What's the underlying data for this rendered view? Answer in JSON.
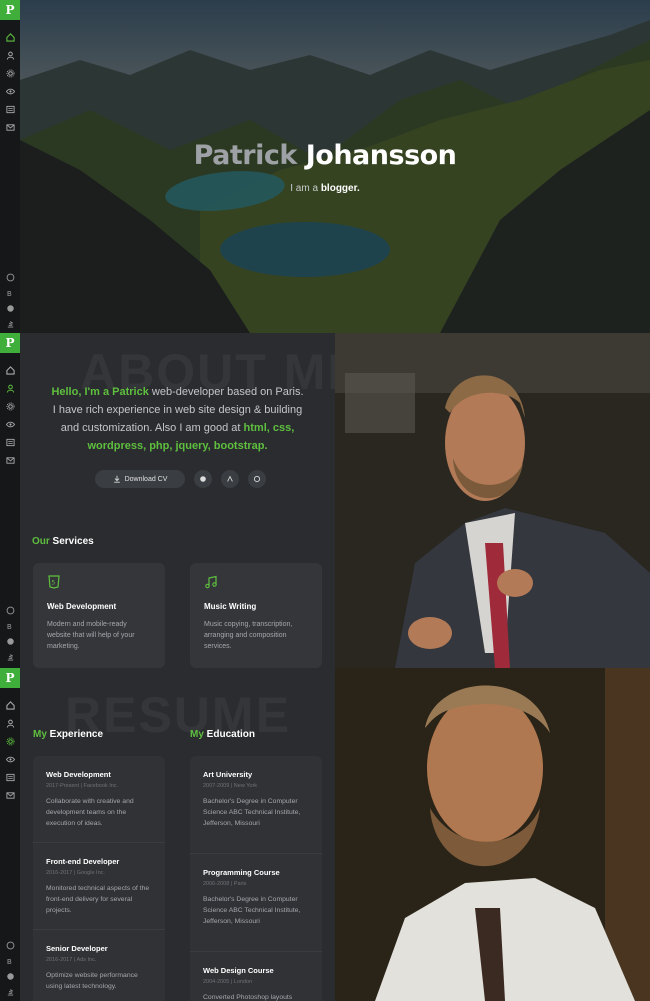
{
  "hero": {
    "first_name": "Patrick",
    "last_name": "Johansson",
    "subtitle_prefix": "I am a",
    "subtitle_role": "blogger."
  },
  "sidebar": {
    "logo": "P",
    "nav_icons": [
      "home-icon",
      "user-icon",
      "gear-icon",
      "eye-icon",
      "document-icon",
      "mail-icon"
    ],
    "social_icons": [
      "dribbble-icon",
      "behance-icon",
      "github-icon",
      "stackoverflow-icon"
    ]
  },
  "about": {
    "bg_word": "ABOUT ME",
    "greeting": "Hello, I'm a Patrick",
    "line1_rest": " web-developer based on Paris.",
    "line2": "I have rich experience in web site design & building",
    "line3_prefix": "and customization. Also I am good at ",
    "skills_a": "html, css,",
    "skills_b": "wordpress, php, jquery, bootstrap.",
    "download_label": "Download CV"
  },
  "services": {
    "title_accent": "Our",
    "title_rest": " Services",
    "items": [
      {
        "title": "Web Development",
        "desc": "Modern and mobile-ready website that will help of your marketing.",
        "icon": "html5-icon"
      },
      {
        "title": "Music Writing",
        "desc": "Music copying, transcription, arranging and composition services.",
        "icon": "music-icon"
      }
    ]
  },
  "resume": {
    "bg_word": "RESUME",
    "experience_accent": "My",
    "experience_rest": " Experience",
    "education_accent": "My",
    "education_rest": " Education",
    "experience": [
      {
        "title": "Web Development",
        "meta": "2017-Present  |  Facebook Inc.",
        "desc": "Collaborate with creative and development teams on the execution of ideas."
      },
      {
        "title": "Front-end Developer",
        "meta": "2016-2017  |  Google Inc.",
        "desc": "Monitored technical aspects of the front-end delivery for several projects."
      },
      {
        "title": "Senior Developer",
        "meta": "2016-2017  |  Ads Inc.",
        "desc": "Optimize website performance using latest technology."
      }
    ],
    "education": [
      {
        "title": "Art University",
        "meta": "2007-2009  |  New York",
        "desc": "Bachelor's Degree in Computer Science ABC Technical Institute, Jefferson, Missouri"
      },
      {
        "title": "Programming Course",
        "meta": "2006-2008  |  Paris",
        "desc": "Bachelor's Degree in Computer Science ABC Technical Institute, Jefferson, Missouri"
      },
      {
        "title": "Web Design Course",
        "meta": "2004-2005  |  London",
        "desc": "Converted Photoshop layouts"
      }
    ]
  },
  "colors": {
    "accent": "#5fbf3f",
    "logo": "#3fae3a",
    "panel": "#2a2c2f"
  }
}
